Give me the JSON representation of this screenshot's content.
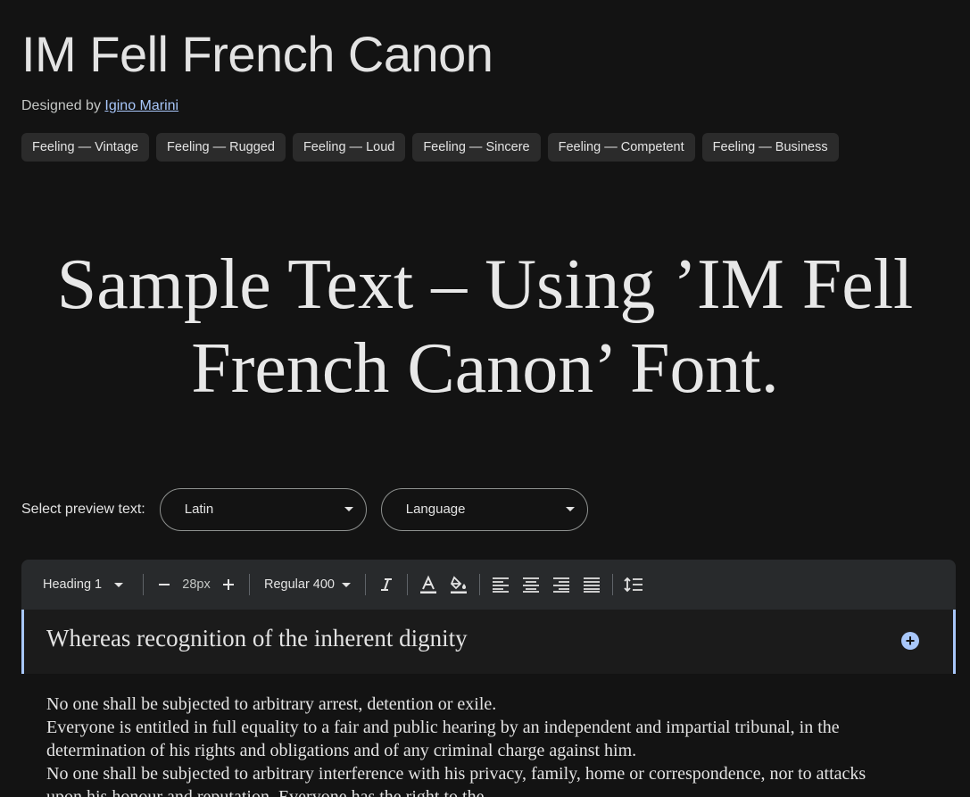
{
  "font": {
    "title": "IM Fell French Canon",
    "designed_by_label": "Designed by",
    "designer": "Igino Marini"
  },
  "tags": [
    "Feeling — Vintage",
    "Feeling — Rugged",
    "Feeling — Loud",
    "Feeling — Sincere",
    "Feeling — Competent",
    "Feeling — Business"
  ],
  "sample_text": "Sample Text – Using ’IM Fell French Canon’ Font.",
  "preview": {
    "label": "Select preview text:",
    "script_select": "Latin",
    "language_select": "Language"
  },
  "toolbar": {
    "style": "Heading 1",
    "size": "28px",
    "weight": "Regular 400",
    "icons": [
      "caret-down-icon",
      "minus-icon",
      "plus-icon",
      "italic-icon",
      "text-color-icon",
      "highlight-color-icon",
      "align-left-icon",
      "align-center-icon",
      "align-right-icon",
      "align-justify-icon",
      "line-height-icon",
      "add-circle-icon"
    ]
  },
  "editor": {
    "heading": "Whereas recognition of the inherent dignity",
    "paragraphs": [
      "No one shall be subjected to arbitrary arrest, detention or exile.",
      "Everyone is entitled in full equality to a fair and public hearing by an independent and impartial tribunal, in the determination of his rights and obligations and of any criminal charge against him.",
      "No one shall be subjected to arbitrary interference with his privacy, family, home or correspondence, nor to attacks upon his honour and reputation. Everyone has the right to the"
    ]
  },
  "colors": {
    "background": "#131313",
    "accent": "#a8c7fa",
    "tag_bg": "#2b2b2b",
    "toolbar_bg": "#282a2c"
  }
}
